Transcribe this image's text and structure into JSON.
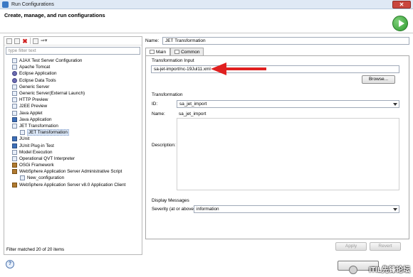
{
  "window": {
    "title": "Run Configurations",
    "heading": "Create, manage, and run configurations",
    "close_label": "✕"
  },
  "left": {
    "filter_placeholder": "type filter text",
    "items": [
      {
        "label": "AJAX Test Server Configuration",
        "icon": "ajax-icon"
      },
      {
        "label": "Apache Tomcat",
        "icon": "server-icon"
      },
      {
        "label": "Eclipse Application",
        "icon": "eclipse-icon"
      },
      {
        "label": "Eclipse Data Tools",
        "icon": "data-tools-icon"
      },
      {
        "label": "Generic Server",
        "icon": "server-icon"
      },
      {
        "label": "Generic Server(External Launch)",
        "icon": "server-icon"
      },
      {
        "label": "HTTP Preview",
        "icon": "server-icon"
      },
      {
        "label": "J2EE Preview",
        "icon": "server-icon"
      },
      {
        "label": "Java Applet",
        "icon": "applet-icon"
      },
      {
        "label": "Java Application",
        "icon": "java-app-icon"
      },
      {
        "label": "JET Transformation",
        "icon": "jet-icon"
      },
      {
        "label": "JET Transformation",
        "icon": "jet-icon",
        "child": true,
        "selected": true
      },
      {
        "label": "JUnit",
        "icon": "junit-icon"
      },
      {
        "label": "JUnit Plug-in Test",
        "icon": "junit-plugin-icon"
      },
      {
        "label": "Model Execution",
        "icon": "model-icon"
      },
      {
        "label": "Operational QVT Interpreter",
        "icon": "qvt-icon"
      },
      {
        "label": "OSGi Framework",
        "icon": "osgi-icon"
      },
      {
        "label": "WebSphere Application Server Administrative Script",
        "icon": "websphere-icon"
      },
      {
        "label": "New_configuration",
        "icon": "config-icon",
        "child": true
      },
      {
        "label": "WebSphere Application Server v8.0 Application Client",
        "icon": "websphere-icon"
      }
    ],
    "filter_status": "Filter matched 20 of 20 items"
  },
  "right": {
    "name_label": "Name:",
    "name_value": "JET Transformation",
    "tabs": [
      {
        "label": "Main",
        "active": true
      },
      {
        "label": "Common",
        "active": false
      }
    ],
    "transformation_input": {
      "title": "Transformation Input",
      "value": "sa-jet-import/nc-19Jul11.xml",
      "browse_label": "Browse..."
    },
    "transformation": {
      "title": "Transformation",
      "id_label": "ID:",
      "id_value": "sa_jet_import",
      "name_label": "Name:",
      "name_value": "sa_jet_import",
      "description_label": "Description:"
    },
    "display_messages": {
      "title": "Display Messages",
      "severity_label": "Severity (at or above):",
      "severity_value": "information"
    },
    "apply_label": "Apply",
    "revert_label": "Revert"
  },
  "bottom": {
    "help_label": "?"
  },
  "watermark": "ITIL先锋论坛",
  "colors": {
    "arrow": "#e02020",
    "selection": "#dae6f6"
  }
}
